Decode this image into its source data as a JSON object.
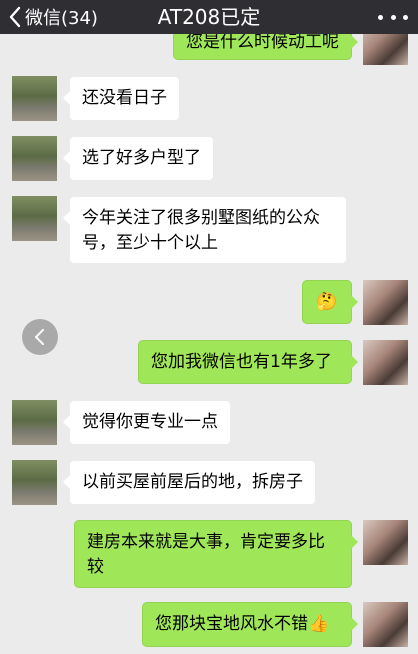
{
  "header": {
    "back_label": "微信(34)",
    "title": "AT208已定"
  },
  "messages": {
    "m0": "您是什么时候动工呢",
    "m1": "还没看日子",
    "m2": "选了好多户型了",
    "m3": "今年关注了很多别墅图纸的公众号，至少十个以上",
    "m4": "🤔",
    "m5": "您加我微信也有1年多了",
    "m6": "觉得你更专业一点",
    "m7": "以前买屋前屋后的地，拆房子",
    "m8": "建房本来就是大事，肯定要多比较",
    "m9": "您那块宝地风水不错👍"
  },
  "colors": {
    "header_bg": "#2e2e33",
    "chat_bg": "#ebebeb",
    "outgoing_bubble": "#9fe658",
    "incoming_bubble": "#ffffff"
  },
  "icons": {
    "back": "chevron-left-icon",
    "more": "more-dots-icon",
    "side_button": "chevron-left-icon"
  }
}
